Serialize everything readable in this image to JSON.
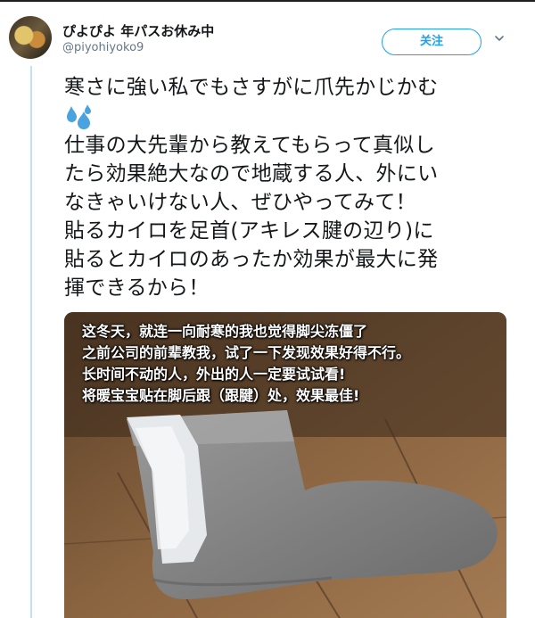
{
  "tweet": {
    "author_name": "ぴよぴよ 年パスお休み中",
    "author_handle": "@piyohiyoko9",
    "follow_label": "关注",
    "text_lines": [
      "寒さに強い私でもさすがに爪先かじかむ",
      "仕事の大先輩から教えてもらって真似し",
      "たら効果絶大なので地蔵する人、外にい",
      "なきゃいけない人、ぜひやってみて！",
      "貼るカイロを足首(アキレス腱の辺り)に",
      "貼るとカイロのあったか効果が最大に発",
      "揮できるから！"
    ],
    "emoji_icon": "sweat-droplets-icon"
  },
  "media": {
    "overlay_lines": [
      "这冬天，就连一向耐寒的我也觉得脚尖冻僵了",
      "之前公司的前辈教我，试了一下发现效果好得不行。",
      "长时间不动的人，外出的人一定要试试看!",
      "将暖宝宝贴在脚后跟（跟腱）处，效果最佳!"
    ]
  },
  "colors": {
    "accent": "#1da1f2",
    "thread_line": "#c4e0f5",
    "text": "#14171a",
    "muted": "#657786"
  }
}
